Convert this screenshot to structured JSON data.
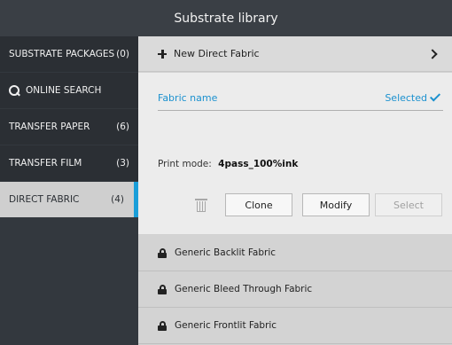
{
  "title": "Substrate library",
  "sidebar": {
    "items": [
      {
        "label": "SUBSTRATE PACKAGES",
        "count": "(0)"
      },
      {
        "label": "ONLINE SEARCH",
        "count": ""
      },
      {
        "label": "TRANSFER PAPER",
        "count": "(6)"
      },
      {
        "label": "TRANSFER FILM",
        "count": "(3)"
      },
      {
        "label": "DIRECT FABRIC",
        "count": "(4)"
      }
    ],
    "active_index": 4
  },
  "main": {
    "new_label": "New Direct Fabric",
    "fabric_name_label": "Fabric name",
    "selected_label": "Selected",
    "print_mode_label": "Print mode:",
    "print_mode_value": "4pass_100%ink",
    "buttons": {
      "clone": "Clone",
      "modify": "Modify",
      "select": "Select"
    },
    "fabrics": [
      {
        "label": "Generic Backlit Fabric"
      },
      {
        "label": "Generic Bleed Through Fabric"
      },
      {
        "label": "Generic Frontlit Fabric"
      }
    ]
  },
  "colors": {
    "accent": "#1b91cf",
    "active_marker": "#1a9ed9",
    "sidebar_bg": "#2b2f34"
  }
}
